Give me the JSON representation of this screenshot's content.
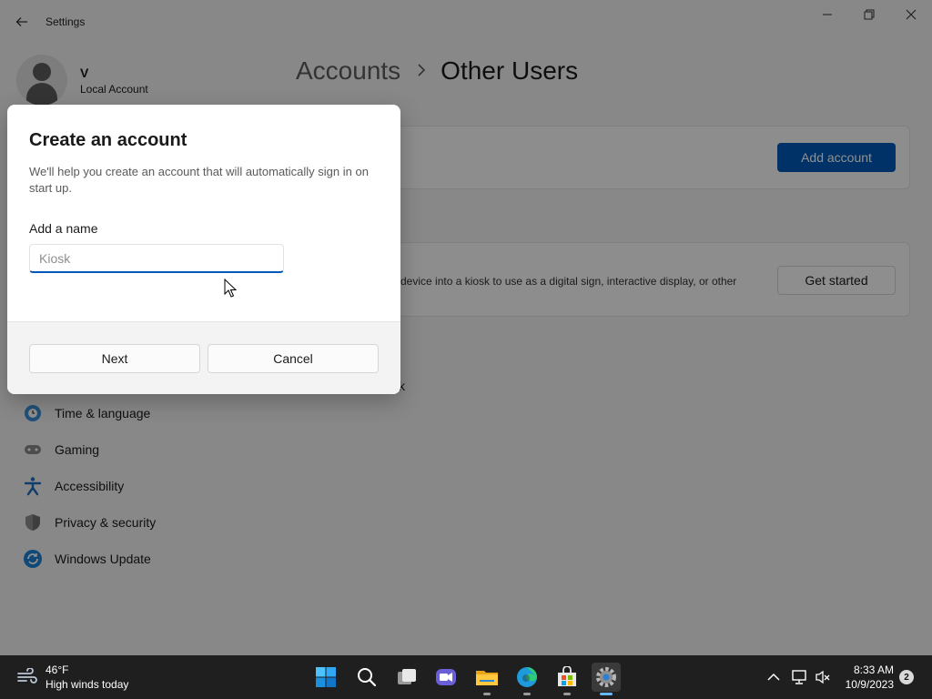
{
  "window": {
    "title": "Settings",
    "profile": {
      "name": "V",
      "account_type": "Local Account"
    }
  },
  "breadcrumb": {
    "parent": "Accounts",
    "current": "Other Users"
  },
  "cards": {
    "add_account_label": "Add account",
    "kiosk_description": "device into a kiosk to use as a digital sign, interactive display, or other",
    "get_started_label": "Get started",
    "kiosk_partial_text": "k"
  },
  "sidebar": {
    "items": [
      {
        "label": "Time & language",
        "icon": "clock-globe-icon"
      },
      {
        "label": "Gaming",
        "icon": "gamepad-icon"
      },
      {
        "label": "Accessibility",
        "icon": "accessibility-icon"
      },
      {
        "label": "Privacy & security",
        "icon": "shield-icon"
      },
      {
        "label": "Windows Update",
        "icon": "refresh-icon"
      }
    ]
  },
  "dialog": {
    "title": "Create an account",
    "description": "We'll help you create an account that will automatically sign in on start up.",
    "name_label": "Add a name",
    "name_placeholder": "Kiosk",
    "name_value": "",
    "next_label": "Next",
    "cancel_label": "Cancel"
  },
  "taskbar": {
    "weather_temp": "46°F",
    "weather_condition": "High winds today",
    "time": "8:33 AM",
    "date": "10/9/2023",
    "notification_count": "2",
    "apps": [
      "start-icon",
      "search-icon",
      "task-view-icon",
      "chat-icon",
      "file-explorer-icon",
      "edge-icon",
      "store-icon",
      "settings-icon"
    ]
  },
  "colors": {
    "accent": "#0059b8",
    "taskbar_bg": "#1f1f1f",
    "window_bg": "#f3f3f3",
    "dim_overlay": "rgba(0,0,0,0.44)"
  }
}
